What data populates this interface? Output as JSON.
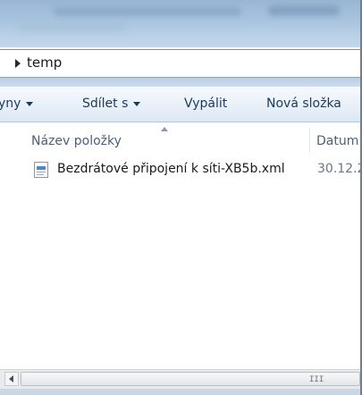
{
  "address_bar": {
    "arrow_icon": "breadcrumb-arrow-icon",
    "path": "temp"
  },
  "command_bar": {
    "items": [
      {
        "label": "yny",
        "has_dropdown": true
      },
      {
        "label": "Sdílet s",
        "has_dropdown": true
      },
      {
        "label": "Vypálit",
        "has_dropdown": false
      },
      {
        "label": "Nová složka",
        "has_dropdown": false
      }
    ]
  },
  "columns": {
    "name": "Název položky",
    "date": "Datum"
  },
  "files": [
    {
      "icon": "xml-file-icon",
      "name": "Bezdrátové připojení k síti-XB5b.xml",
      "date": "30.12.2"
    }
  ],
  "scrollbar": {
    "left_arrow": "scroll-left-icon",
    "grip": "III"
  },
  "colors": {
    "title_glass": "#a7c2dd",
    "command_text": "#1e395b",
    "header_text": "#4c607a",
    "xml_icon_accent": "#4a88c7"
  }
}
